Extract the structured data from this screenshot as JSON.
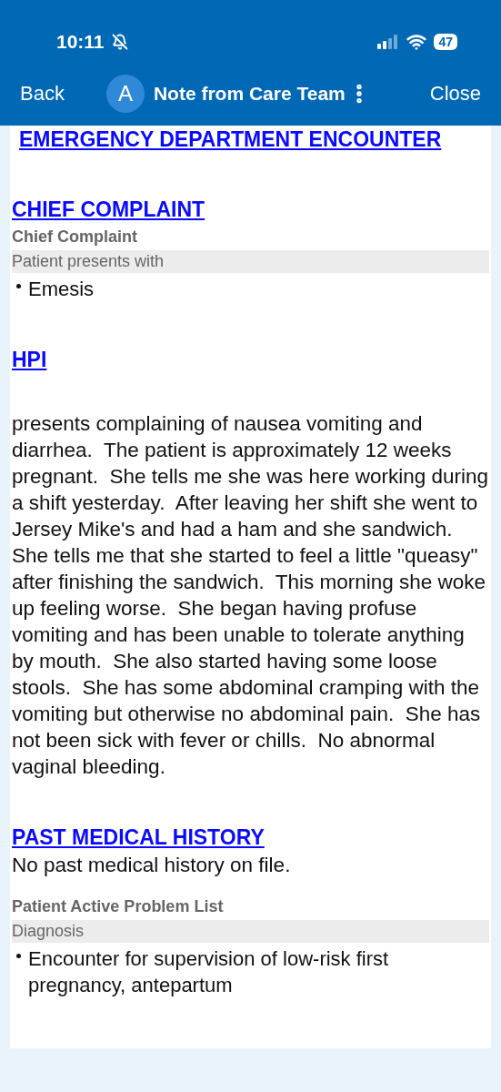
{
  "status_bar": {
    "time": "10:11",
    "battery": "47"
  },
  "nav": {
    "back": "Back",
    "avatar": "A",
    "title": "Note from Care Team",
    "close": "Close"
  },
  "blocks": [
    {
      "kind": "heading",
      "text": "EMERGENCY DEPARTMENT ENCOUNTER"
    },
    {
      "kind": "heading",
      "text": "CHIEF COMPLAINT"
    },
    {
      "kind": "label",
      "text": "Chief Complaint"
    },
    {
      "kind": "band",
      "text": "Patient presents with"
    },
    {
      "kind": "bullet",
      "text": "Emesis"
    },
    {
      "kind": "heading",
      "text": "HPI"
    },
    {
      "kind": "paragraph",
      "text": "presents complaining of nausea vomiting and diarrhea.  The patient is approximately 12 weeks pregnant.  She tells me she was here working during a shift yesterday.  After leaving her shift she went to Jersey Mike's and had a ham and she sandwich.  She tells me that she started to feel a little \"queasy\" after finishing the sandwich.  This morning she woke up feeling worse.  She began having profuse vomiting and has been unable to tolerate anything by mouth.  She also started having some loose stools.  She has some abdominal cramping with the vomiting but otherwise no abdominal pain.  She has not been sick with fever or chills.  No abnormal vaginal bleeding."
    },
    {
      "kind": "heading",
      "text": "PAST MEDICAL HISTORY"
    },
    {
      "kind": "text",
      "text": "No past medical history on file."
    },
    {
      "kind": "label",
      "text": "Patient Active Problem List"
    },
    {
      "kind": "band",
      "text": "Diagnosis"
    },
    {
      "kind": "bullet",
      "text": "Encounter for supervision of low-risk first pregnancy, antepartum"
    }
  ]
}
